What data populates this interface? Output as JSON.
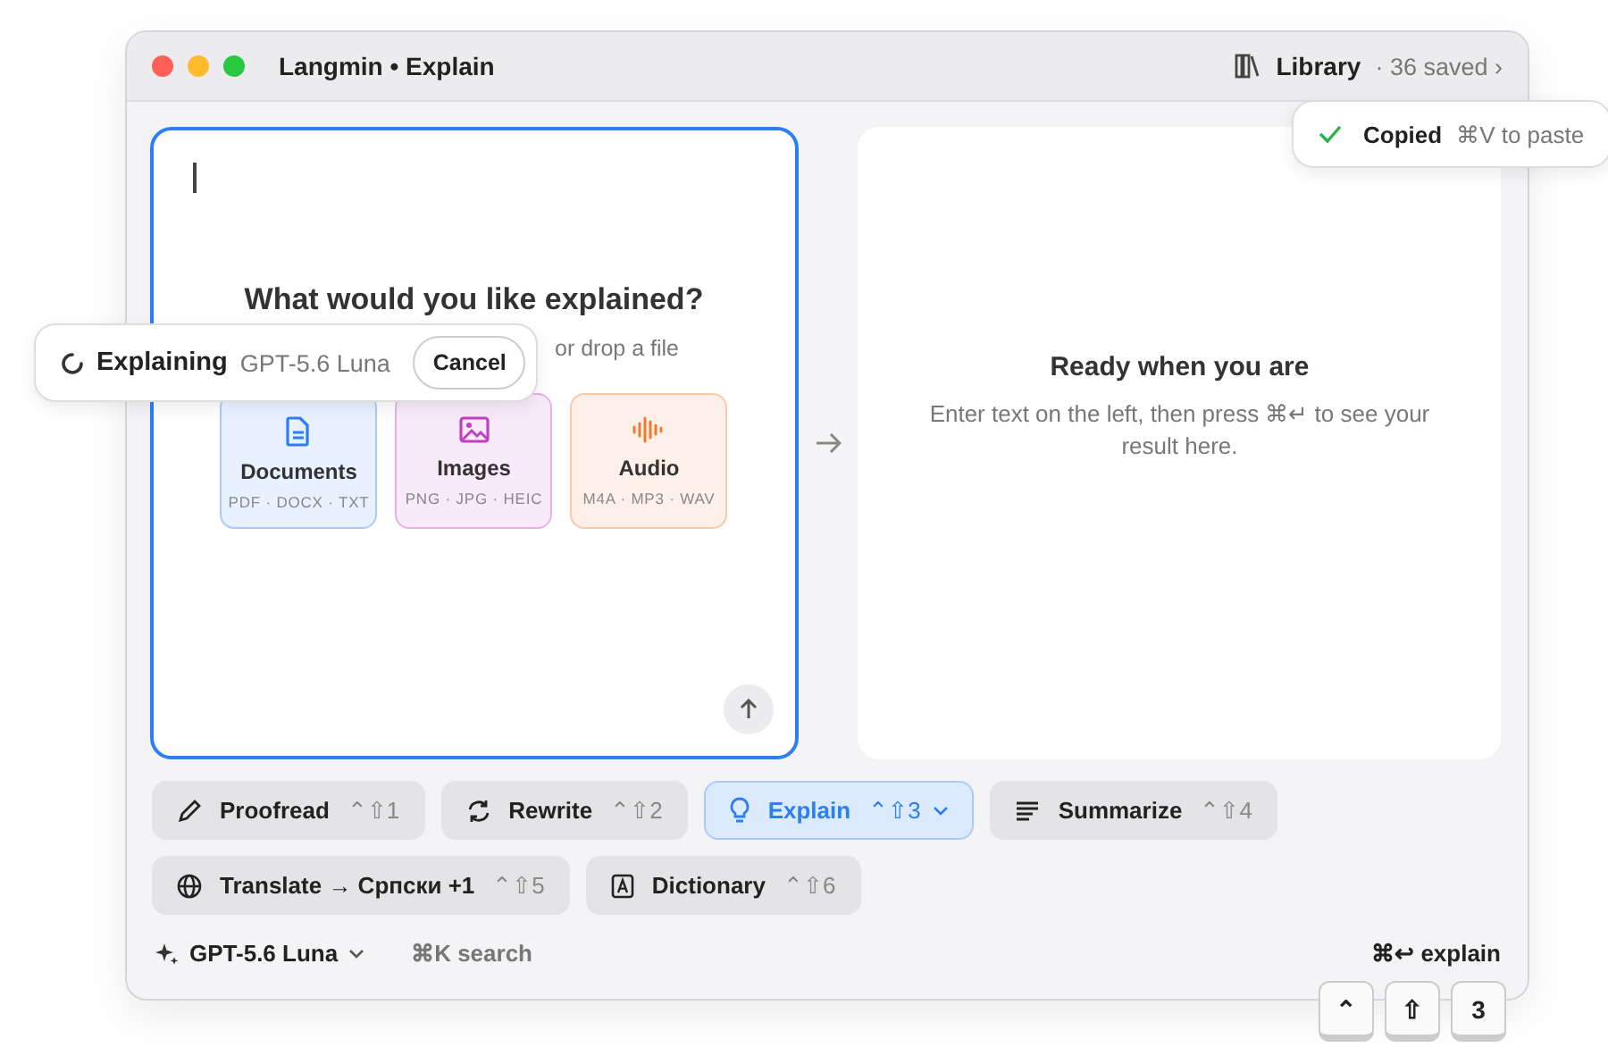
{
  "window": {
    "title": "Langmin • Explain"
  },
  "library": {
    "label": "Library",
    "count": "· 36 saved ›"
  },
  "copied_toast": {
    "label": "Copied",
    "hint": "⌘V to paste"
  },
  "editor": {
    "heading": "What would you like explained?",
    "subtitle": "or drop a file",
    "file_types": [
      {
        "kind": "document",
        "label": "Documents",
        "formats": "PDF · DOCX · TXT",
        "color": "#2f7cf6"
      },
      {
        "kind": "image",
        "label": "Images",
        "formats": "PNG · JPG · HEIC",
        "color": "#c23fc0"
      },
      {
        "kind": "audio",
        "label": "Audio",
        "formats": "M4A · MP3 · WAV",
        "color": "#f07a2e"
      }
    ]
  },
  "progress": {
    "label": "Explaining",
    "model": "GPT-5.6 Luna",
    "cancel": "Cancel"
  },
  "result": {
    "heading": "Ready when you are",
    "body": "Enter text on the left, then press ⌘↵ to see your result here."
  },
  "actions": [
    {
      "kind": "pencil",
      "label": "Proofread",
      "shortcut": "⌃⇧1",
      "selected": false,
      "menu": false
    },
    {
      "kind": "refresh",
      "label": "Rewrite",
      "shortcut": "⌃⇧2",
      "selected": false,
      "menu": false
    },
    {
      "kind": "bulb",
      "label": "Explain",
      "shortcut": "⌃⇧3",
      "selected": true,
      "menu": true
    },
    {
      "kind": "lines",
      "label": "Summarize",
      "shortcut": "⌃⇧4",
      "selected": false,
      "menu": false
    },
    {
      "kind": "globe",
      "label": "Translate → Српски +1",
      "shortcut": "⌃⇧5",
      "selected": false,
      "menu": false
    },
    {
      "kind": "letter",
      "label": "Dictionary",
      "shortcut": "⌃⇧6",
      "selected": false,
      "menu": false
    }
  ],
  "footer": {
    "model": "GPT-5.6 Luna",
    "search_hint": "⌘K search",
    "submit_hint": "⌘↩ explain"
  },
  "keys": [
    "⌃",
    "⇧",
    "3"
  ]
}
